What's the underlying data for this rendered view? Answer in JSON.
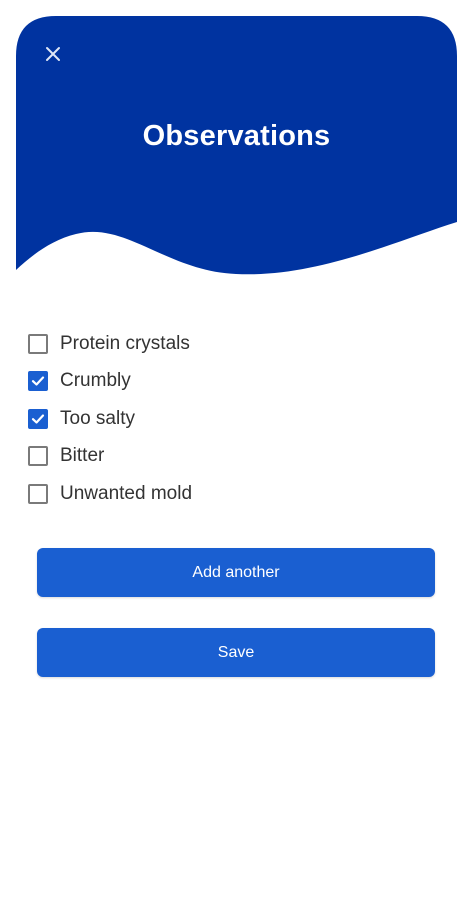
{
  "header": {
    "title": "Observations",
    "close_icon": "close-icon",
    "background_color": "#0033a0"
  },
  "options": [
    {
      "label": "Protein crystals",
      "checked": false
    },
    {
      "label": "Crumbly",
      "checked": true
    },
    {
      "label": "Too salty",
      "checked": true
    },
    {
      "label": "Bitter",
      "checked": false
    },
    {
      "label": "Unwanted mold",
      "checked": false
    }
  ],
  "buttons": {
    "add_another": "Add another",
    "save": "Save",
    "color": "#1a5fd1"
  }
}
